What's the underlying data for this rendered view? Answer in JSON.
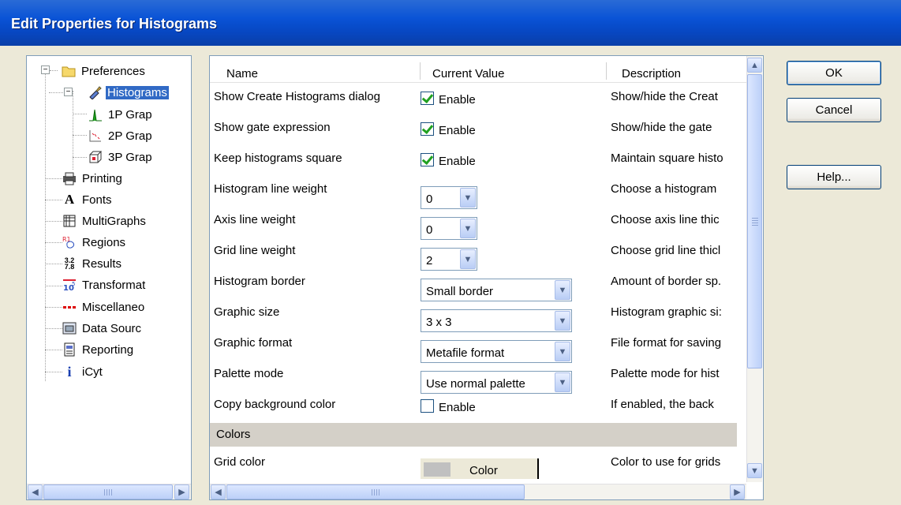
{
  "window": {
    "title": "Edit Properties for Histograms"
  },
  "tree": {
    "items": [
      {
        "label": "Preferences",
        "icon": "folder-icon"
      },
      {
        "label": "Histograms",
        "icon": "brush-icon",
        "selected": true
      },
      {
        "label": "1P Grap",
        "icon": "1p-graph-icon"
      },
      {
        "label": "2P Grap",
        "icon": "2p-graph-icon"
      },
      {
        "label": "3P Grap",
        "icon": "3p-graph-icon"
      },
      {
        "label": "Printing",
        "icon": "printer-icon"
      },
      {
        "label": "Fonts",
        "icon": "font-icon"
      },
      {
        "label": "MultiGraphs",
        "icon": "multigraph-icon"
      },
      {
        "label": "Regions",
        "icon": "regions-icon"
      },
      {
        "label": "Results",
        "icon": "results-icon"
      },
      {
        "label": "Transformat",
        "icon": "transform-icon"
      },
      {
        "label": "Miscellaneo",
        "icon": "misc-icon"
      },
      {
        "label": "Data Sourc",
        "icon": "data-source-icon"
      },
      {
        "label": "Reporting",
        "icon": "reporting-icon"
      },
      {
        "label": "iCyt",
        "icon": "info-icon"
      }
    ]
  },
  "grid": {
    "headers": {
      "name": "Name",
      "value": "Current Value",
      "description": "Description"
    },
    "rows": [
      {
        "name": "Show Create Histograms dialog",
        "type": "check",
        "checked": true,
        "value": "Enable",
        "description": "Show/hide the Creat"
      },
      {
        "name": "Show gate expression",
        "type": "check",
        "checked": true,
        "value": "Enable",
        "description": "Show/hide the gate"
      },
      {
        "name": "Keep histograms square",
        "type": "check",
        "checked": true,
        "value": "Enable",
        "description": "Maintain square histo"
      },
      {
        "name": "Histogram line weight",
        "type": "combo-small",
        "value": "0",
        "description": "Choose a histogram"
      },
      {
        "name": "Axis line weight",
        "type": "combo-small",
        "value": "0",
        "description": "Choose axis line thic"
      },
      {
        "name": "Grid line weight",
        "type": "combo-small",
        "value": "2",
        "description": "Choose grid line thicl"
      },
      {
        "name": "Histogram border",
        "type": "combo",
        "value": "Small border",
        "description": "Amount of border sp."
      },
      {
        "name": "Graphic size",
        "type": "combo",
        "value": "3 x 3",
        "description": "Histogram graphic si:"
      },
      {
        "name": "Graphic format",
        "type": "combo",
        "value": "Metafile format",
        "description": "File format for saving"
      },
      {
        "name": "Palette mode",
        "type": "combo",
        "value": "Use normal palette",
        "description": "Palette mode for hist"
      },
      {
        "name": "Copy background color",
        "type": "check",
        "checked": false,
        "value": "Enable",
        "description": "If enabled, the back"
      }
    ],
    "section": "Colors",
    "color_row": {
      "name": "Grid color",
      "value": "Color",
      "description": "Color to use for grids",
      "swatch": "#c0c0c0"
    }
  },
  "buttons": {
    "ok": "OK",
    "cancel": "Cancel",
    "help": "Help..."
  },
  "colors": {
    "titlebar": "#0a53d6",
    "selection": "#316ac5",
    "checkmark": "#21a121"
  }
}
